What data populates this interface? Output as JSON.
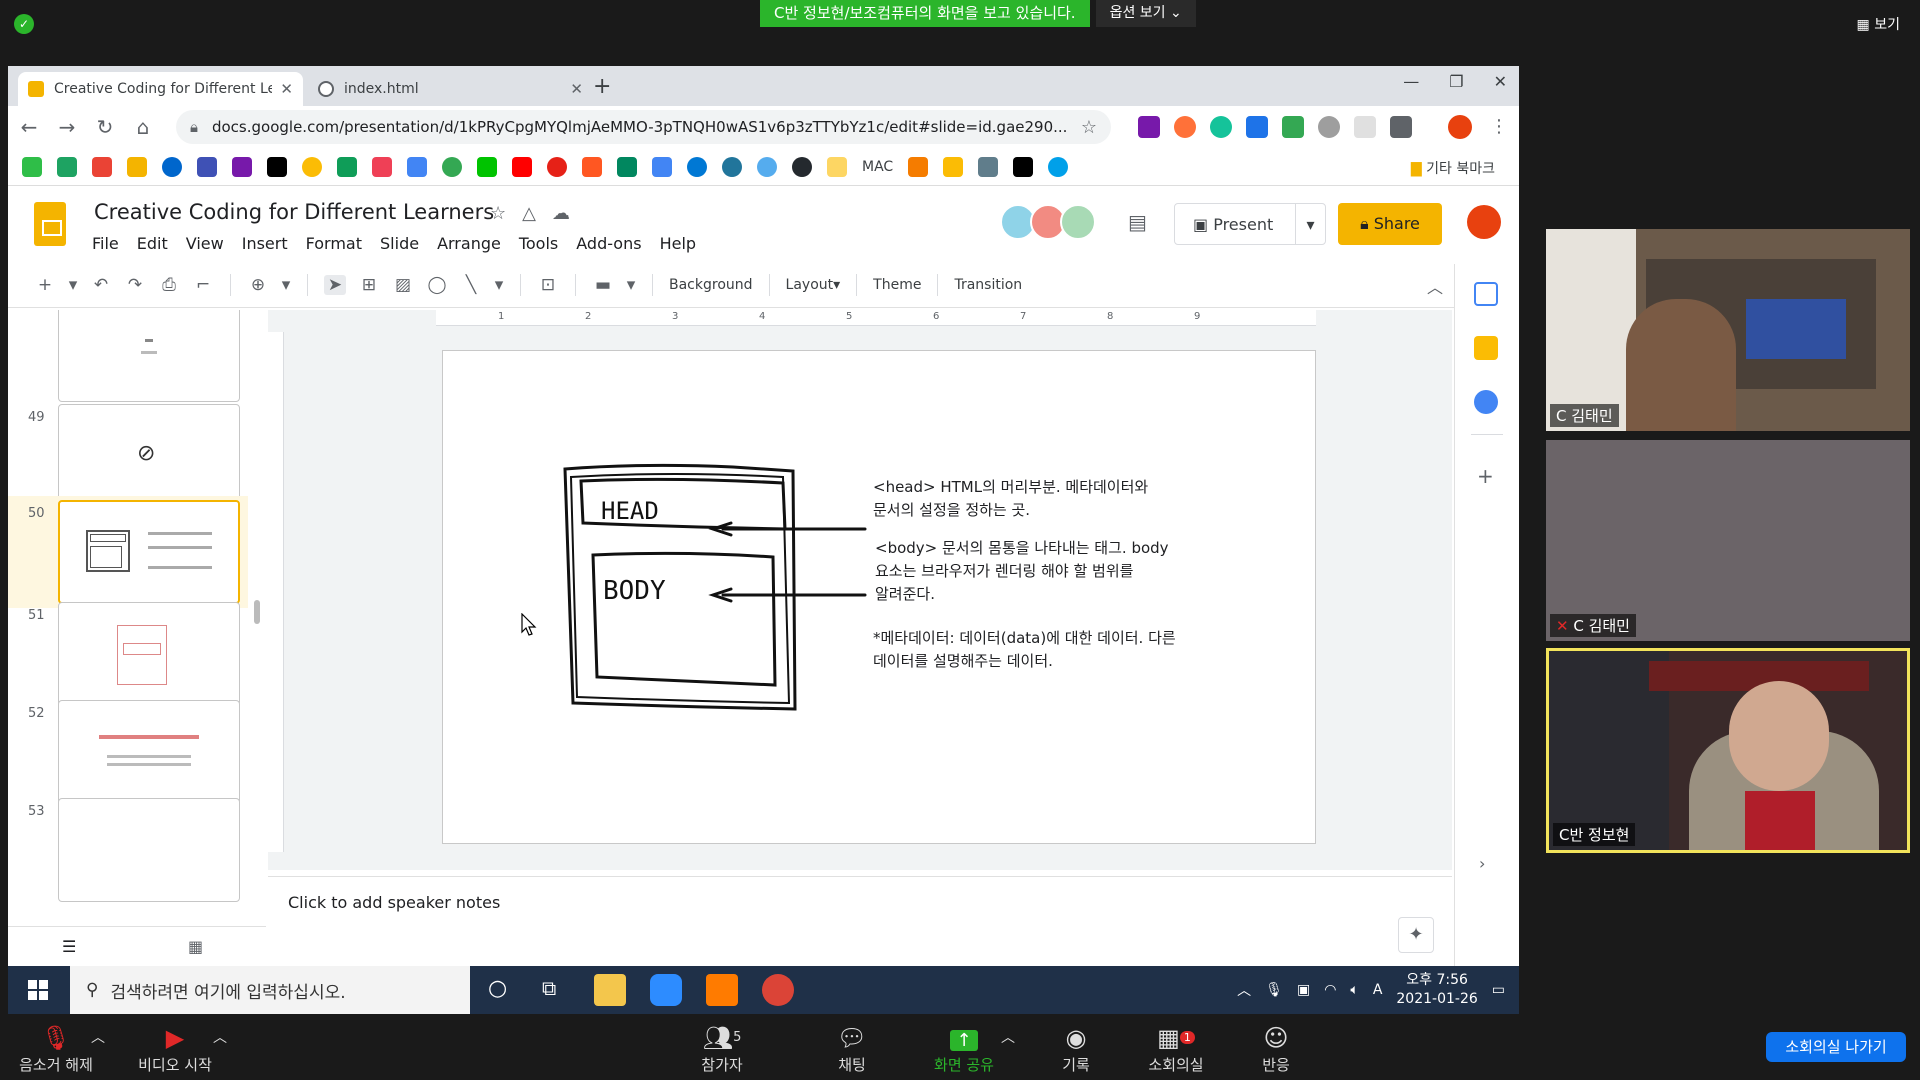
{
  "zoom": {
    "banner": "C반 정보현/보조컴퓨터의 화면을 보고 있습니다.",
    "view_options": "옵션 보기 ⌄",
    "view_button": "보기",
    "bottom": {
      "mute": "음소거 해제",
      "video": "비디오 시작",
      "participants": "참가자",
      "participants_count": "5",
      "chat": "채팅",
      "share": "화면 공유",
      "record": "기록",
      "breakout": "소회의실",
      "breakout_badge": "1",
      "reactions": "반응",
      "leave": "소회의실 나가기"
    },
    "tiles": [
      {
        "name": "C 김태민"
      },
      {
        "name": "C 김태민"
      },
      {
        "name": "C반 정보현"
      }
    ]
  },
  "browser": {
    "tabs": [
      {
        "label": "Creative Coding for Different Le"
      },
      {
        "label": "index.html"
      }
    ],
    "url": "docs.google.com/presentation/d/1kPRyCpgMYQlmjAeMMO-3pTNQH0wAS1v6p3zTTYbYz1c/edit#slide=id.gae290...",
    "bookmark_mac": "MAC",
    "other_bookmarks": "기타 북마크"
  },
  "slides": {
    "title": "Creative Coding for Different Learners",
    "menu": [
      "File",
      "Edit",
      "View",
      "Insert",
      "Format",
      "Slide",
      "Arrange",
      "Tools",
      "Add-ons",
      "Help"
    ],
    "present": "Present",
    "share": "Share",
    "toolbar": {
      "background": "Background",
      "layout": "Layout▾",
      "theme": "Theme",
      "transition": "Transition"
    },
    "filmstrip": [
      {
        "num": ""
      },
      {
        "num": "49"
      },
      {
        "num": "50"
      },
      {
        "num": "51"
      },
      {
        "num": "52"
      },
      {
        "num": "53"
      }
    ],
    "ruler": [
      "1",
      "2",
      "3",
      "4",
      "5",
      "6",
      "7",
      "8",
      "9"
    ],
    "slide": {
      "head_label": "HEAD",
      "body_label": "BODY",
      "note1_l1": "<head> HTML의 머리부분. 메타데이터와",
      "note1_l2": "문서의 설정을 정하는 곳.",
      "note2_l1": "<body> 문서의 몸통을 나타내는 태그. body",
      "note2_l2": "요소는 브라우저가 렌더링 해야 할 범위를",
      "note2_l3": "알려준다.",
      "note3_l1": "*메타데이터: 데이터(data)에 대한 데이터. 다른",
      "note3_l2": "데이터를 설명해주는 데이터."
    },
    "speaker_notes": "Click to add speaker notes"
  },
  "taskbar": {
    "search": "검색하려면 여기에 입력하십시오.",
    "time": "오후 7:56",
    "date": "2021-01-26",
    "ime": "A"
  }
}
